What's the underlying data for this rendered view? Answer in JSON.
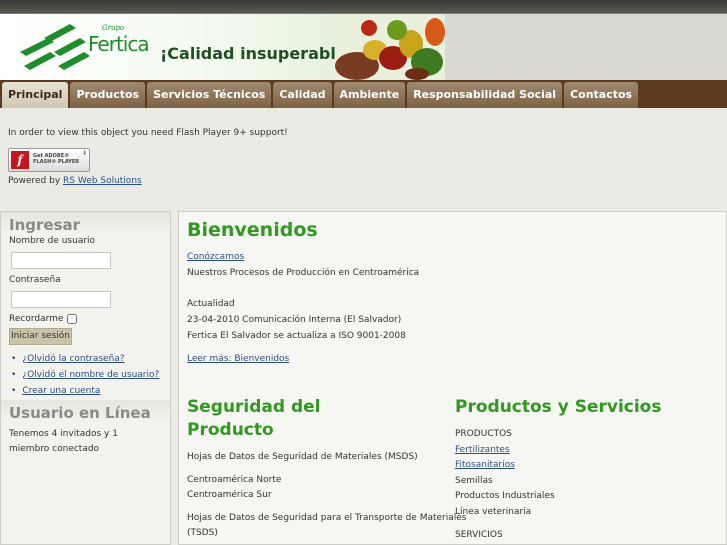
{
  "banner": {
    "brand_small": "Grupo",
    "brand": "Fertica",
    "tagline": "¡Calidad insuperable!",
    "logo_icon": "fertica-logo-icon",
    "fruit_image": "fruits-vegetables-image"
  },
  "nav": {
    "items": [
      "Principal",
      "Productos",
      "Servicios Técnicos",
      "Calidad",
      "Ambiente",
      "Responsabilidad Social",
      "Contactos"
    ],
    "active": "Principal"
  },
  "flash": {
    "message": "In order to view this object you need Flash Player 9+ support!",
    "button_line1": "Get ADOBE®",
    "button_line2": "FLASH® PLAYER",
    "icon": "adobe-flash-icon",
    "powered_prefix": "Powered by",
    "powered_link": "RS Web Solutions"
  },
  "login": {
    "title": "Ingresar",
    "username_label": "Nombre de usuario",
    "username_value": "",
    "password_label": "Contraseña",
    "password_value": "",
    "remember_label": "Recordarme",
    "submit": "Iniciar sesión",
    "links": [
      "¿Olvidó la contraseña?",
      "¿Olvidó el nombre de usuario?",
      "Crear una cuenta"
    ]
  },
  "online": {
    "title": "Usuario en Línea",
    "text": "Tenemos 4 invitados y 1 miembro conectado"
  },
  "main": {
    "title": "Bienvenidos",
    "conozcamos_link": "Conózcamos",
    "conozcamos_text": "Nuestros Procesos de Producción en Centroamérica",
    "actualidad_label": "Actualidad",
    "news_date": "23-04-2010  Comunicación Interna (El Salvador)",
    "news_text": "Fertica El Salvador se actualiza a ISO 9001-2008",
    "read_more": "Leer más: Bienvenidos",
    "seguridad": {
      "title_line1": "Seguridad del",
      "title_line2": "Producto",
      "msds": "Hojas de Datos de Seguridad de Materiales (MSDS)",
      "region1": "Centroamérica Norte",
      "region2": "Centroamérica Sur",
      "transporte_line1": "Hojas de Datos de Seguridad para el Transporte de Materiales",
      "transporte_line2": "(TSDS)"
    },
    "productos": {
      "title": "Productos y Servicios",
      "heading": "PRODUCTOS",
      "links": [
        "Fertilizantes",
        "Fitosanitarios"
      ],
      "items": [
        "Semillas",
        "Productos Industriales",
        "Línea veterinaria"
      ],
      "services_heading": "SERVICIOS"
    }
  }
}
